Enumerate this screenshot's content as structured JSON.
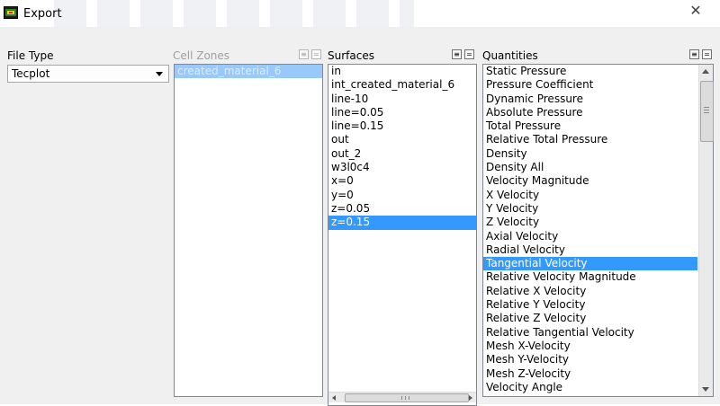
{
  "window": {
    "title": "Export",
    "app_icon": "fluent-app-icon",
    "close_icon": "close-icon",
    "close_glyph": "✕"
  },
  "file_type": {
    "label": "File Type",
    "selected": "Tecplot",
    "dropdown_icon": "chevron-down-icon"
  },
  "cell_zones": {
    "label": "Cell Zones",
    "enabled": false,
    "items": [
      {
        "label": "created_material_6",
        "selected": true
      }
    ]
  },
  "surfaces": {
    "label": "Surfaces",
    "items": [
      {
        "label": "in",
        "selected": false
      },
      {
        "label": "int_created_material_6",
        "selected": false
      },
      {
        "label": "line-10",
        "selected": false
      },
      {
        "label": "line=0.05",
        "selected": false
      },
      {
        "label": "line=0.15",
        "selected": false
      },
      {
        "label": "out",
        "selected": false
      },
      {
        "label": "out_2",
        "selected": false
      },
      {
        "label": "w3l0c4",
        "selected": false
      },
      {
        "label": "x=0",
        "selected": false
      },
      {
        "label": "y=0",
        "selected": false
      },
      {
        "label": "z=0.05",
        "selected": false
      },
      {
        "label": "z=0.15",
        "selected": true
      }
    ]
  },
  "quantities": {
    "label": "Quantities",
    "items": [
      {
        "label": "Static Pressure",
        "selected": false
      },
      {
        "label": "Pressure Coefficient",
        "selected": false
      },
      {
        "label": "Dynamic Pressure",
        "selected": false
      },
      {
        "label": "Absolute Pressure",
        "selected": false
      },
      {
        "label": "Total Pressure",
        "selected": false
      },
      {
        "label": "Relative Total Pressure",
        "selected": false
      },
      {
        "label": "Density",
        "selected": false
      },
      {
        "label": "Density All",
        "selected": false
      },
      {
        "label": "Velocity Magnitude",
        "selected": false
      },
      {
        "label": "X Velocity",
        "selected": false
      },
      {
        "label": "Y Velocity",
        "selected": false
      },
      {
        "label": "Z Velocity",
        "selected": false
      },
      {
        "label": "Axial Velocity",
        "selected": false
      },
      {
        "label": "Radial Velocity",
        "selected": false
      },
      {
        "label": "Tangential Velocity",
        "selected": true
      },
      {
        "label": "Relative Velocity Magnitude",
        "selected": false
      },
      {
        "label": "Relative X Velocity",
        "selected": false
      },
      {
        "label": "Relative Y Velocity",
        "selected": false
      },
      {
        "label": "Relative Z Velocity",
        "selected": false
      },
      {
        "label": "Relative Tangential Velocity",
        "selected": false
      },
      {
        "label": "Mesh X-Velocity",
        "selected": false
      },
      {
        "label": "Mesh Y-Velocity",
        "selected": false
      },
      {
        "label": "Mesh Z-Velocity",
        "selected": false
      },
      {
        "label": "Velocity Angle",
        "selected": false
      }
    ]
  },
  "scroll_grip": "III",
  "colors": {
    "selection": "#3399ff",
    "selection_disabled": "#99c9fb",
    "dialog_bg": "#f0f0f0"
  }
}
